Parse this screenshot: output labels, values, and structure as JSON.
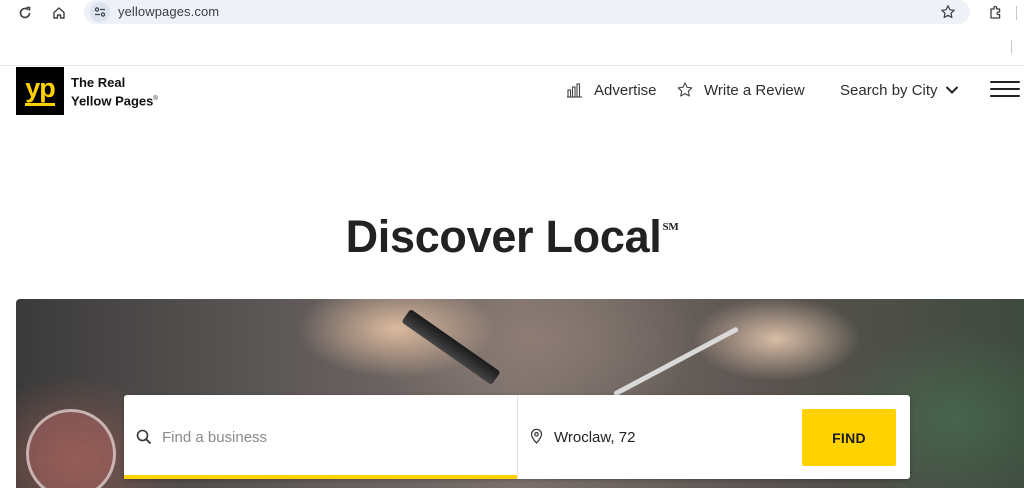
{
  "browser": {
    "url": "yellowpages.com",
    "icons": {
      "reload": "reload-icon",
      "home": "home-icon",
      "site_info": "site-settings-icon",
      "bookmark": "star-icon",
      "extensions": "puzzle-icon"
    }
  },
  "header": {
    "logo_text": "yp",
    "brand_line1": "The Real",
    "brand_line2": "Yellow Pages",
    "brand_mark": "®",
    "nav": {
      "advertise": "Advertise",
      "write_review": "Write a Review",
      "search_by_city": "Search by City"
    }
  },
  "hero": {
    "title": "Discover Local",
    "title_mark": "SM"
  },
  "search": {
    "what_placeholder": "Find a business",
    "where_value": "Wroclaw, 72",
    "find_label": "FIND"
  },
  "colors": {
    "brand_yellow": "#ffd200",
    "logo_background": "#000000",
    "text_dark": "#222222"
  }
}
